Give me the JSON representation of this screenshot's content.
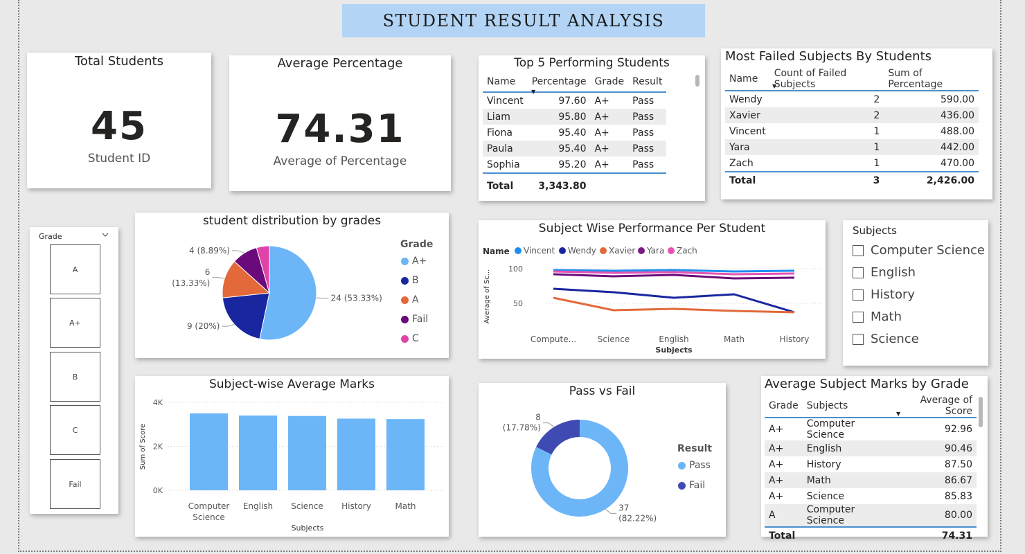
{
  "dashboard_title": "STUDENT  RESULT  ANALYSIS",
  "total_students": {
    "title": "Total Students",
    "value": "45",
    "subtitle": "Student ID"
  },
  "average_percentage": {
    "title": "Average Percentage",
    "value": "74.31",
    "subtitle": "Average of Percentage"
  },
  "top5": {
    "title": "Top 5 Performing Students",
    "headers": [
      "Name",
      "Percentage",
      "Grade",
      "Result"
    ],
    "rows": [
      {
        "name": "Vincent",
        "pct": "97.60",
        "grade": "A+",
        "result": "Pass"
      },
      {
        "name": "Liam",
        "pct": "95.80",
        "grade": "A+",
        "result": "Pass"
      },
      {
        "name": "Fiona",
        "pct": "95.40",
        "grade": "A+",
        "result": "Pass"
      },
      {
        "name": "Paula",
        "pct": "95.40",
        "grade": "A+",
        "result": "Pass"
      },
      {
        "name": "Sophia",
        "pct": "95.20",
        "grade": "A+",
        "result": "Pass"
      }
    ],
    "total_label": "Total",
    "total_value": "3,343.80"
  },
  "failed_subjects": {
    "title": "Most Failed Subjects By Students",
    "headers": [
      "Name",
      "Count of Failed Subjects",
      "Sum of Percentage"
    ],
    "rows": [
      {
        "name": "Wendy",
        "count": "2",
        "sum": "590.00"
      },
      {
        "name": "Xavier",
        "count": "2",
        "sum": "436.00"
      },
      {
        "name": "Vincent",
        "count": "1",
        "sum": "488.00"
      },
      {
        "name": "Yara",
        "count": "1",
        "sum": "442.00"
      },
      {
        "name": "Zach",
        "count": "1",
        "sum": "470.00"
      }
    ],
    "total_label": "Total",
    "total_count": "3",
    "total_sum": "2,426.00"
  },
  "grade_slicer": {
    "title": "Grade",
    "options": [
      "A",
      "A+",
      "B",
      "C",
      "Fail"
    ]
  },
  "subjects_slicer": {
    "title": "Subjects",
    "options": [
      "Computer Science",
      "English",
      "History",
      "Math",
      "Science"
    ]
  },
  "avg_by_grade": {
    "title": "Average Subject Marks by Grade",
    "headers": [
      "Grade",
      "Subjects",
      "Average of Score"
    ],
    "rows": [
      {
        "grade": "A+",
        "subject": "Computer Science",
        "avg": "92.96"
      },
      {
        "grade": "A+",
        "subject": "English",
        "avg": "90.46"
      },
      {
        "grade": "A+",
        "subject": "History",
        "avg": "87.50"
      },
      {
        "grade": "A+",
        "subject": "Math",
        "avg": "86.67"
      },
      {
        "grade": "A+",
        "subject": "Science",
        "avg": "85.83"
      },
      {
        "grade": "A",
        "subject": "Computer Science",
        "avg": "80.00"
      }
    ],
    "total_label": "Total",
    "total_value": "74.31"
  },
  "colors": {
    "light_blue": "#6cb6f8",
    "navy": "#1826a0",
    "orange": "#e3693a",
    "purple": "#6b0a7a",
    "pink": "#e044a8",
    "fail_blue": "#3f4bb3",
    "vincent": "#1e8ef0",
    "yara": "#7a1a84",
    "zach": "#e553b3"
  },
  "chart_data": [
    {
      "type": "pie",
      "title": "student distribution by grades",
      "legend_title": "Grade",
      "legend": [
        "A+",
        "B",
        "A",
        "Fail",
        "C"
      ],
      "slices": [
        {
          "label": "A+",
          "value": 24,
          "text": "24 (53.33%)",
          "color": "#6cb6f8"
        },
        {
          "label": "B",
          "value": 9,
          "text": "9 (20%)",
          "color": "#1826a0"
        },
        {
          "label": "A",
          "value": 6,
          "text_lines": [
            "6",
            "(13.33%)"
          ],
          "color": "#e3693a"
        },
        {
          "label": "Fail",
          "value": 4,
          "text": "4 (8.89%)",
          "color": "#6b0a7a"
        },
        {
          "label": "C",
          "value": 2,
          "color": "#e044a8"
        }
      ],
      "legend_placement": "right"
    },
    {
      "type": "line",
      "title": "Subject Wise Performance Per Student",
      "legend_title": "Name",
      "categories": [
        "Compute...",
        "Science",
        "English",
        "Math",
        "History"
      ],
      "xlabel": "Subjects",
      "ylabel": "Average of Sc...",
      "yticks": [
        100,
        50
      ],
      "ylim": [
        25,
        110
      ],
      "series": [
        {
          "name": "Vincent",
          "color": "#1e8ef0",
          "values": [
            98,
            97,
            98,
            96,
            97
          ]
        },
        {
          "name": "Wendy",
          "color": "#1826a0",
          "values": [
            71,
            66,
            58,
            63,
            37
          ]
        },
        {
          "name": "Xavier",
          "color": "#e3693a",
          "values": [
            58,
            40,
            42,
            39,
            37
          ]
        },
        {
          "name": "Yara",
          "color": "#6b0a7a",
          "values": [
            92,
            89,
            91,
            86,
            87
          ]
        },
        {
          "name": "Zach",
          "color": "#e553b3",
          "values": [
            96,
            94,
            95,
            92,
            93
          ]
        }
      ],
      "grid": true
    },
    {
      "type": "bar",
      "title": "Subject-wise Average Marks",
      "categories": [
        [
          "Computer",
          "Science"
        ],
        [
          "English"
        ],
        [
          "Science"
        ],
        [
          "History"
        ],
        [
          "Math"
        ]
      ],
      "values": [
        3500,
        3400,
        3380,
        3260,
        3240
      ],
      "xlabel": "Subjects",
      "ylabel": "Sum of Score",
      "yticks": [
        "4K",
        "2K",
        "0K"
      ],
      "ylim": [
        0,
        4000
      ],
      "color": "#6cb6f8",
      "grid": true
    },
    {
      "type": "pie",
      "subtype": "donut",
      "title": "Pass vs Fail",
      "legend_title": "Result",
      "legend": [
        "Pass",
        "Fail"
      ],
      "slices": [
        {
          "label": "Pass",
          "value": 37,
          "text_lines": [
            "37",
            "(82.22%)"
          ],
          "color": "#6cb6f8"
        },
        {
          "label": "Fail",
          "value": 8,
          "text_lines": [
            "8",
            "(17.78%)"
          ],
          "color": "#3f4bb3"
        }
      ],
      "legend_placement": "right"
    }
  ]
}
